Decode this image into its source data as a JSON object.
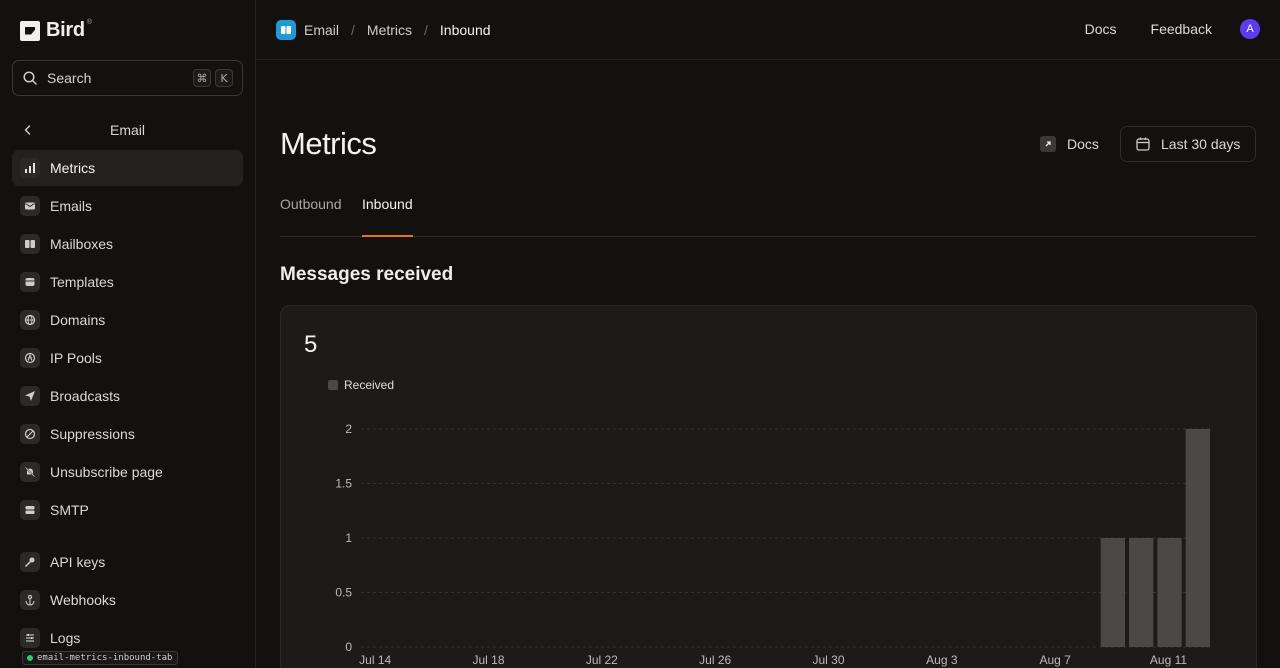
{
  "brand": {
    "name": "Bird",
    "tm": "®"
  },
  "search": {
    "label": "Search",
    "kbd_mod": "⌘",
    "kbd_key": "K"
  },
  "sidebar": {
    "section_title": "Email",
    "items": [
      {
        "label": "Metrics",
        "icon": "bar-chart-icon",
        "active": true
      },
      {
        "label": "Emails",
        "icon": "envelope-icon"
      },
      {
        "label": "Mailboxes",
        "icon": "mailbox-icon"
      },
      {
        "label": "Templates",
        "icon": "template-icon"
      },
      {
        "label": "Domains",
        "icon": "globe-icon"
      },
      {
        "label": "IP Pools",
        "icon": "ip-pool-icon"
      },
      {
        "label": "Broadcasts",
        "icon": "send-icon"
      },
      {
        "label": "Suppressions",
        "icon": "block-icon"
      },
      {
        "label": "Unsubscribe page",
        "icon": "bell-off-icon"
      },
      {
        "label": "SMTP",
        "icon": "server-icon"
      }
    ],
    "items2": [
      {
        "label": "API keys",
        "icon": "key-icon"
      },
      {
        "label": "Webhooks",
        "icon": "webhook-icon"
      },
      {
        "label": "Logs",
        "icon": "logs-icon"
      }
    ],
    "tag": "email-metrics-inbound-tab"
  },
  "topbar": {
    "crumbs": [
      "Email",
      "Metrics",
      "Inbound"
    ],
    "docs": "Docs",
    "feedback": "Feedback",
    "avatar": "A"
  },
  "page": {
    "title": "Metrics",
    "docs_label": "Docs",
    "date_range": "Last 30 days",
    "tabs": [
      {
        "label": "Outbound",
        "active": false
      },
      {
        "label": "Inbound",
        "active": true
      }
    ],
    "section_title": "Messages received",
    "total": "5",
    "legend": "Received"
  },
  "colors": {
    "accent": "#e8731c",
    "bar": "#4a4946",
    "avatar": "#5b3cf0",
    "app_icon": "#1e9ad6"
  },
  "chart_data": {
    "type": "bar",
    "series": [
      {
        "name": "Received",
        "color": "#4a4946"
      }
    ],
    "categories": [
      "Jul 14",
      "Jul 15",
      "Jul 16",
      "Jul 17",
      "Jul 18",
      "Jul 19",
      "Jul 20",
      "Jul 21",
      "Jul 22",
      "Jul 23",
      "Jul 24",
      "Jul 25",
      "Jul 26",
      "Jul 27",
      "Jul 28",
      "Jul 29",
      "Jul 30",
      "Jul 31",
      "Aug 1",
      "Aug 2",
      "Aug 3",
      "Aug 4",
      "Aug 5",
      "Aug 6",
      "Aug 7",
      "Aug 8",
      "Aug 9",
      "Aug 10",
      "Aug 11",
      "Aug 12"
    ],
    "values": [
      0,
      0,
      0,
      0,
      0,
      0,
      0,
      0,
      0,
      0,
      0,
      0,
      0,
      0,
      0,
      0,
      0,
      0,
      0,
      0,
      0,
      0,
      0,
      0,
      0,
      0,
      1,
      1,
      1,
      2
    ],
    "x_tick_labels": [
      "Jul 14",
      "Jul 18",
      "Jul 22",
      "Jul 26",
      "Jul 30",
      "Aug 3",
      "Aug 7",
      "Aug 11"
    ],
    "y_ticks": [
      0,
      0.5,
      1,
      1.5,
      2
    ],
    "ylim": [
      0,
      2
    ],
    "grid": true,
    "legend": "top-left"
  }
}
